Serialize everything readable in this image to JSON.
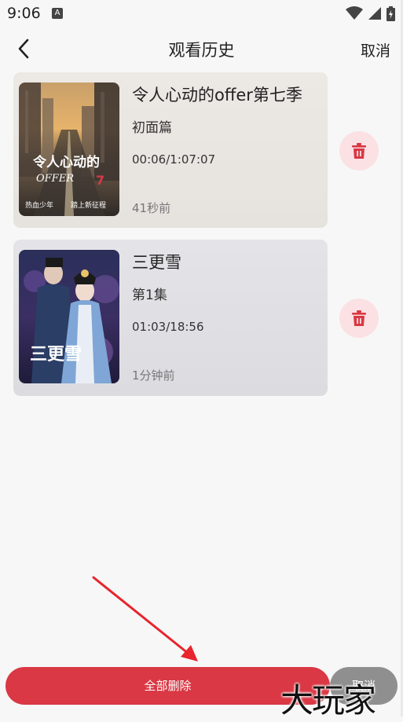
{
  "status": {
    "time": "9:06",
    "a_badge": "A"
  },
  "header": {
    "title": "观看历史",
    "cancel": "取消"
  },
  "history": [
    {
      "title": "令人心动的offer第七季",
      "episode": "初面篇",
      "progress": "00:06/1:07:07",
      "ago": "41秒前",
      "poster_text": "令人心动的",
      "poster_sub": "OFFER",
      "poster_tag1": "热血少年",
      "poster_tag2": "踏上新征程"
    },
    {
      "title": "三更雪",
      "episode": "第1集",
      "progress": "01:03/18:56",
      "ago": "1分钟前",
      "poster_text": "三更雪"
    }
  ],
  "footer": {
    "delete_all": "全部删除",
    "cancel": "取消"
  },
  "watermark": "大玩家",
  "colors": {
    "accent_red": "#d93844",
    "delete_bg": "#fbe1e3",
    "delete_icon": "#d93844"
  }
}
